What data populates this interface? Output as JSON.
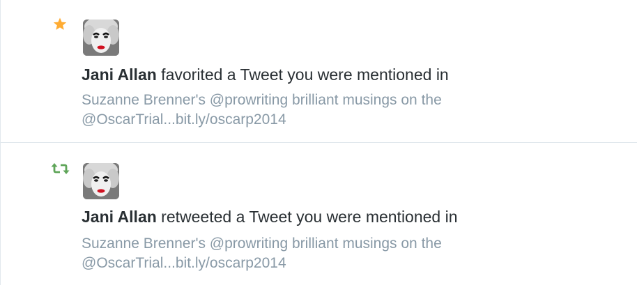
{
  "notifications": [
    {
      "type_icon": "star-icon",
      "type_color": "#ffac33",
      "user_name": "Jani Allan",
      "action_text": " favorited a Tweet you were mentioned in",
      "tweet_line1": "Suzanne Brenner's @prowriting brilliant musings on the",
      "tweet_line2": "@OscarTrial...bit.ly/oscarp2014"
    },
    {
      "type_icon": "retweet-icon",
      "type_color": "#5fa559",
      "user_name": "Jani Allan",
      "action_text": " retweeted a Tweet you were mentioned in",
      "tweet_line1": "Suzanne Brenner's @prowriting brilliant musings on the",
      "tweet_line2": "@OscarTrial...bit.ly/oscarp2014"
    }
  ]
}
